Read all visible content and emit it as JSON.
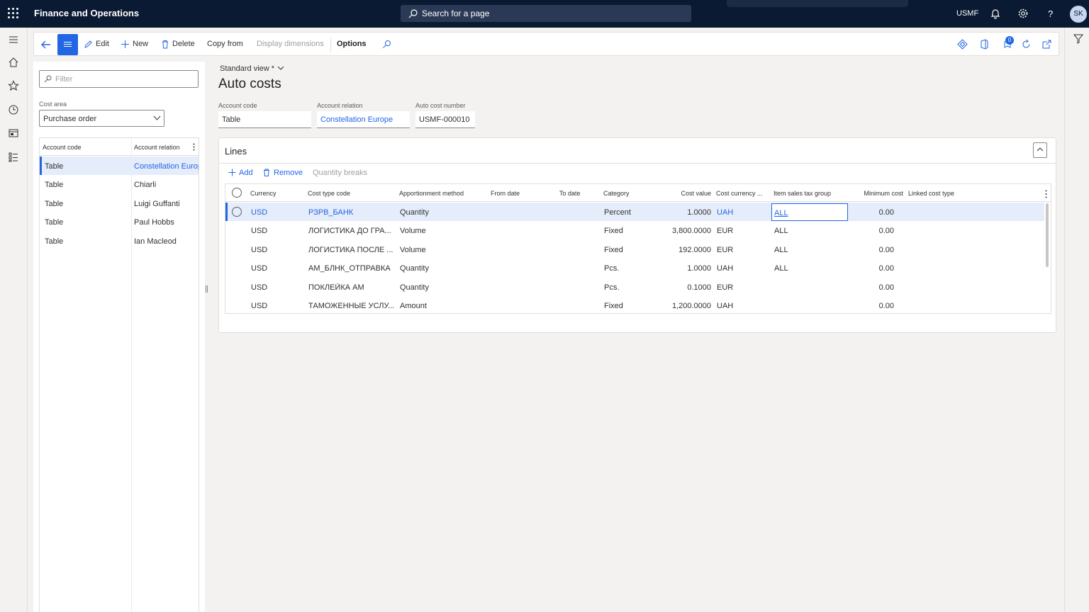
{
  "topbar": {
    "app_title": "Finance and Operations",
    "search_placeholder": "Search for a page",
    "company": "USMF",
    "avatar_initials": "SK"
  },
  "action_pane": {
    "edit": "Edit",
    "new": "New",
    "delete": "Delete",
    "copy_from": "Copy from",
    "display_dimensions": "Display dimensions",
    "options": "Options",
    "badge_count": "0"
  },
  "list_pane": {
    "filter_placeholder": "Filter",
    "cost_area_label": "Cost area",
    "cost_area_value": "Purchase order",
    "columns": [
      "Account code",
      "Account relation"
    ],
    "rows": [
      {
        "code": "Table",
        "relation": "Constellation Europe",
        "selected": true
      },
      {
        "code": "Table",
        "relation": "Chiarli",
        "selected": false
      },
      {
        "code": "Table",
        "relation": "Luigi Guffanti",
        "selected": false
      },
      {
        "code": "Table",
        "relation": "Paul Hobbs",
        "selected": false
      },
      {
        "code": "Table",
        "relation": "Ian Macleod",
        "selected": false
      }
    ]
  },
  "main": {
    "view_name": "Standard view *",
    "page_title": "Auto costs",
    "header": {
      "account_code_label": "Account code",
      "account_code_value": "Table",
      "account_relation_label": "Account relation",
      "account_relation_value": "Constellation Europe",
      "auto_cost_number_label": "Auto cost number",
      "auto_cost_number_value": "USMF-000010"
    },
    "lines": {
      "title": "Lines",
      "add": "Add",
      "remove": "Remove",
      "quantity_breaks": "Quantity breaks",
      "columns": {
        "currency": "Currency",
        "cost_type_code": "Cost type code",
        "apportionment_method": "Apportionment method",
        "from_date": "From date",
        "to_date": "To date",
        "category": "Category",
        "cost_value": "Cost value",
        "cost_currency": "Cost currency ...",
        "item_sales_tax_group": "Item sales tax group",
        "minimum_cost": "Minimum cost",
        "linked_cost_type": "Linked cost type"
      },
      "rows": [
        {
          "currency": "USD",
          "cost_type": "РЗРВ_БАНК",
          "method": "Quantity",
          "category": "Percent",
          "value": "1.0000",
          "cost_currency": "UAH",
          "tax_group": "ALL",
          "min_cost": "0.00",
          "selected": true
        },
        {
          "currency": "USD",
          "cost_type": "ЛОГИСТИКА ДО ГРА...",
          "method": "Volume",
          "category": "Fixed",
          "value": "3,800.0000",
          "cost_currency": "EUR",
          "tax_group": "ALL",
          "min_cost": "0.00",
          "selected": false
        },
        {
          "currency": "USD",
          "cost_type": "ЛОГИСТИКА ПОСЛЕ ...",
          "method": "Volume",
          "category": "Fixed",
          "value": "192.0000",
          "cost_currency": "EUR",
          "tax_group": "ALL",
          "min_cost": "0.00",
          "selected": false
        },
        {
          "currency": "USD",
          "cost_type": "АМ_БЛНК_ОТПРАВКА",
          "method": "Quantity",
          "category": "Pcs.",
          "value": "1.0000",
          "cost_currency": "UAH",
          "tax_group": "ALL",
          "min_cost": "0.00",
          "selected": false
        },
        {
          "currency": "USD",
          "cost_type": "ПОКЛЕЙКА АМ",
          "method": "Quantity",
          "category": "Pcs.",
          "value": "0.1000",
          "cost_currency": "EUR",
          "tax_group": "",
          "min_cost": "0.00",
          "selected": false
        },
        {
          "currency": "USD",
          "cost_type": "ТАМОЖЕННЫЕ УСЛУ...",
          "method": "Amount",
          "category": "Fixed",
          "value": "1,200.0000",
          "cost_currency": "UAH",
          "tax_group": "",
          "min_cost": "0.00",
          "selected": false
        }
      ]
    }
  },
  "colors": {
    "nav_bg": "#0b1a33",
    "accent": "#2266e3",
    "selected_row": "#e5ecfa"
  }
}
